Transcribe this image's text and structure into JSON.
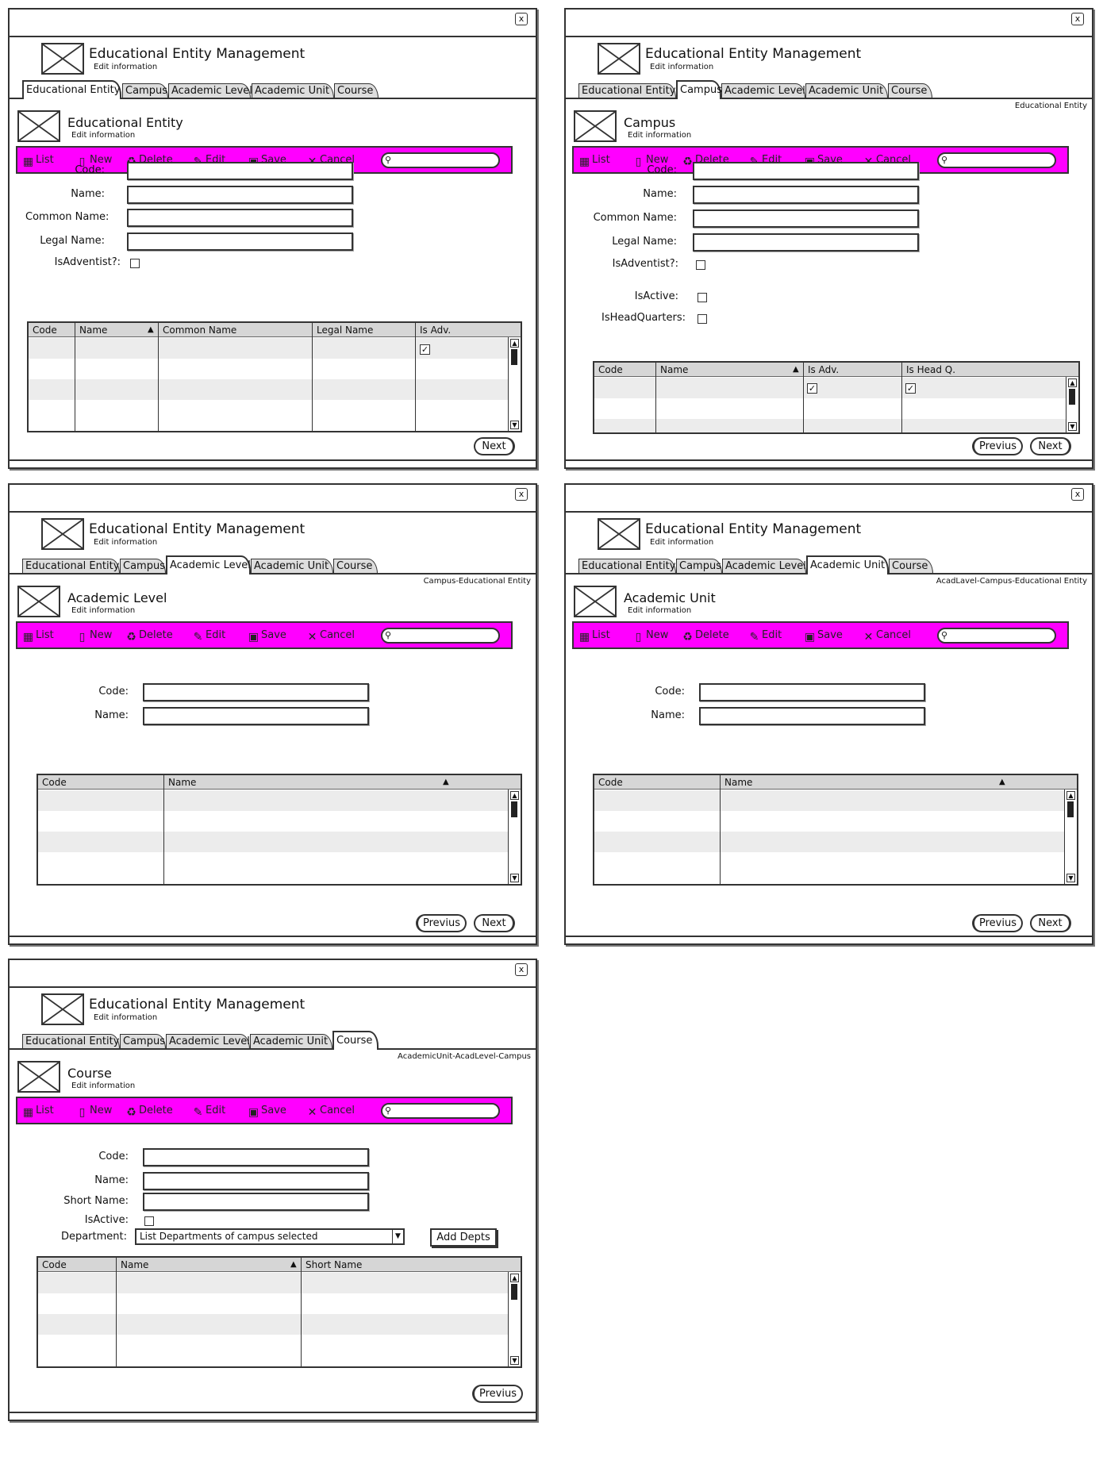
{
  "app": {
    "title": "Educational Entity Management",
    "subtitle": "Edit information",
    "close_symbol": "x",
    "tabs": [
      "Educational Entity",
      "Campus",
      "Academic Level",
      "Academic Unit",
      "Course"
    ]
  },
  "toolbar": {
    "list": "List",
    "new": "New",
    "delete": "Delete",
    "edit": "Edit",
    "save": "Save",
    "cancel": "Cancel",
    "search_icon": "search-icon",
    "color": "#ff00ff"
  },
  "screens": {
    "educational_entity": {
      "section_title": "Educational Entity",
      "section_subtitle": "Edit information",
      "labels": {
        "code": "Code:",
        "name": "Name:",
        "common_name": "Common Name:",
        "legal_name": "Legal Name:",
        "is_adventist": "IsAdventist?:"
      },
      "columns": [
        "Code",
        "Name",
        "Common Name",
        "Legal Name",
        "Is Adv."
      ],
      "next": "Next"
    },
    "campus": {
      "breadcrumb": "Educational Entity",
      "section_title": "Campus",
      "section_subtitle": "Edit information",
      "labels": {
        "code": "Code:",
        "name": "Name:",
        "common_name": "Common Name:",
        "legal_name": "Legal Name:",
        "is_adventist": "IsAdventist?:",
        "is_active": "IsActive:",
        "is_headquarters": "IsHeadQuarters:"
      },
      "columns": [
        "Code",
        "Name",
        "Is Adv.",
        "Is Head Q."
      ],
      "prev": "Previus",
      "next": "Next"
    },
    "academic_level": {
      "breadcrumb": "Campus-Educational Entity",
      "section_title": "Academic Level",
      "section_subtitle": "Edit information",
      "labels": {
        "code": "Code:",
        "name": "Name:"
      },
      "columns": [
        "Code",
        "Name"
      ],
      "prev": "Previus",
      "next": "Next"
    },
    "academic_unit": {
      "breadcrumb": "AcadLavel-Campus-Educational Entity",
      "section_title": "Academic Unit",
      "section_subtitle": "Edit information",
      "labels": {
        "code": "Code:",
        "name": "Name:"
      },
      "columns": [
        "Code",
        "Name"
      ],
      "prev": "Previus",
      "next": "Next"
    },
    "course": {
      "breadcrumb": "AcademicUnit-AcadLevel-Campus",
      "section_title": "Course",
      "section_subtitle": "Edit information",
      "labels": {
        "code": "Code:",
        "name": "Name:",
        "short_name": "Short Name:",
        "is_active": "IsActive:",
        "department": "Department:"
      },
      "department_select": "List Departments of campus selected",
      "add_depts": "Add Depts",
      "columns": [
        "Code",
        "Name",
        "Short Name"
      ],
      "prev": "Previus"
    }
  }
}
